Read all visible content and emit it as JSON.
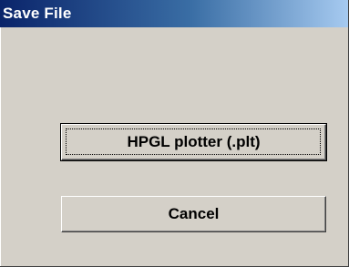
{
  "window": {
    "title": "Save File"
  },
  "buttons": {
    "hpgl_label": "HPGL plotter (.plt)",
    "cancel_label": "Cancel"
  },
  "colors": {
    "title_bar_start": "#0a246a",
    "title_bar_end": "#a6caf0",
    "dialog_face": "#d4d0c8"
  }
}
